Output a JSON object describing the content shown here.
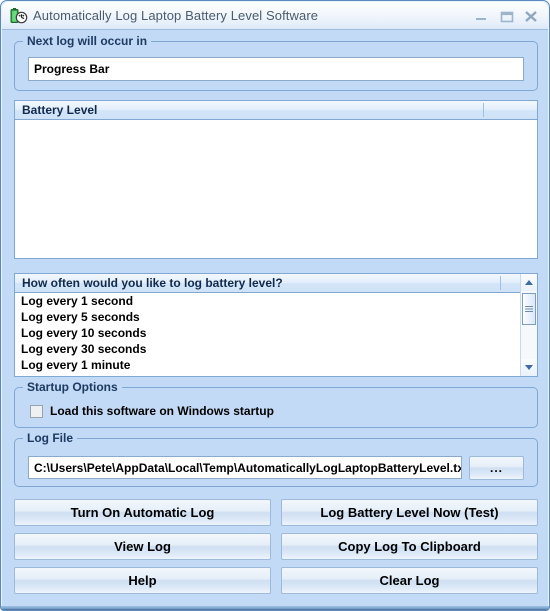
{
  "window": {
    "title": "Automatically Log Laptop Battery Level Software",
    "icon": "battery-clock-icon",
    "controls": {
      "minimize": "minimize-icon",
      "maximize": "maximize-icon",
      "close": "close-icon"
    },
    "colors": {
      "background": "#c3daf6",
      "border": "#5b87bd",
      "title_text": "#4a5b6e",
      "group_title": "#1d3a61",
      "field_background": "#ffffff"
    }
  },
  "next_log_group": {
    "title": "Next log will occur in",
    "progress": {
      "value": "Progress Bar"
    }
  },
  "battery_level_list": {
    "columns": [
      "Battery Level",
      ""
    ],
    "rows": []
  },
  "interval_list": {
    "columns": [
      "How often would you like to log battery level?",
      ""
    ],
    "rows": [
      "Log every 1 second",
      "Log every 5 seconds",
      "Log every 10 seconds",
      "Log every 30 seconds",
      "Log every 1 minute"
    ],
    "scrollbar": {
      "up_arrow": "scroll-up-icon",
      "down_arrow": "scroll-down-icon"
    }
  },
  "startup_group": {
    "title": "Startup Options",
    "checkbox": {
      "label": "Load this software on Windows startup",
      "checked": false
    }
  },
  "log_file_group": {
    "title": "Log File",
    "path": "C:\\Users\\Pete\\AppData\\Local\\Temp\\AutomaticallyLogLaptopBatteryLevel.txt",
    "browse_label": "..."
  },
  "buttons": {
    "turn_on_automatic_log": "Turn On Automatic Log",
    "log_battery_level_now": "Log Battery Level Now (Test)",
    "view_log": "View Log",
    "copy_log_to_clipboard": "Copy Log To Clipboard",
    "help": "Help",
    "clear_log": "Clear Log"
  }
}
